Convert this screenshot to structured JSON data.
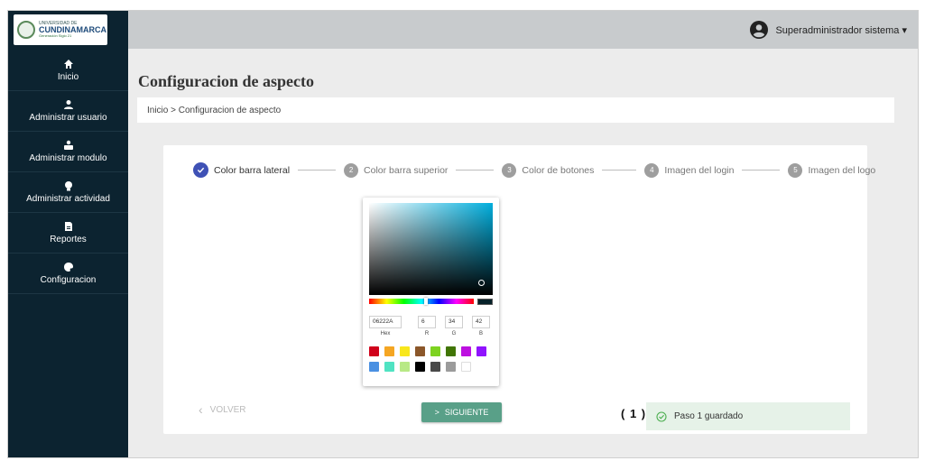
{
  "logo": {
    "line1": "UNIVERSIDAD DE",
    "line2": "CUNDINAMARCA",
    "line3": "Generación Siglo 21"
  },
  "sidebar": {
    "items": [
      {
        "label": "Inicio",
        "icon": "home-icon"
      },
      {
        "label": "Administrar usuario",
        "icon": "user-icon"
      },
      {
        "label": "Administrar modulo",
        "icon": "module-icon"
      },
      {
        "label": "Administrar actividad",
        "icon": "activity-icon"
      },
      {
        "label": "Reportes",
        "icon": "file-icon"
      },
      {
        "label": "Configuracion",
        "icon": "palette-icon"
      }
    ]
  },
  "topbar": {
    "user": "Superadministrador sistema ▾"
  },
  "page": {
    "title": "Configuracion de aspecto"
  },
  "breadcrumb": {
    "home": "Inicio",
    "separator": " > ",
    "current": "Configuracion de aspecto"
  },
  "stepper": {
    "steps": [
      {
        "num": "✓",
        "label": "Color barra lateral",
        "state": "done"
      },
      {
        "num": "2",
        "label": "Color barra superior",
        "state": "pending"
      },
      {
        "num": "3",
        "label": "Color de botones",
        "state": "pending"
      },
      {
        "num": "4",
        "label": "Imagen del login",
        "state": "pending"
      },
      {
        "num": "5",
        "label": "Imagen del logo",
        "state": "pending"
      }
    ]
  },
  "picker": {
    "hex": "06222A",
    "r": "6",
    "g": "34",
    "b": "42",
    "hex_label": "Hex",
    "r_label": "R",
    "g_label": "G",
    "b_label": "B",
    "preview_color": "#06222A",
    "swatches": [
      "#d0021b",
      "#f5a623",
      "#f8e71c",
      "#8b572a",
      "#7ed321",
      "#417505",
      "#bd10e0",
      "#9013fe",
      "#4a90e2",
      "#50e3c2",
      "#b8e986",
      "#000000",
      "#4a4a4a",
      "#9b9b9b",
      "#ffffff"
    ]
  },
  "actions": {
    "back_label": "VOLVER",
    "back_icon": "chevron-left-icon",
    "next_label": "SIGUIENTE",
    "next_icon": "chevron-right-icon"
  },
  "status": {
    "count": "( 1 )",
    "message": "Paso 1 guardado",
    "icon": "check-circle-icon"
  },
  "colors": {
    "sidebar": "#0c2330",
    "topbar": "#c8cbcd",
    "accent_button": "#59a088",
    "step_done": "#3f51b5"
  }
}
